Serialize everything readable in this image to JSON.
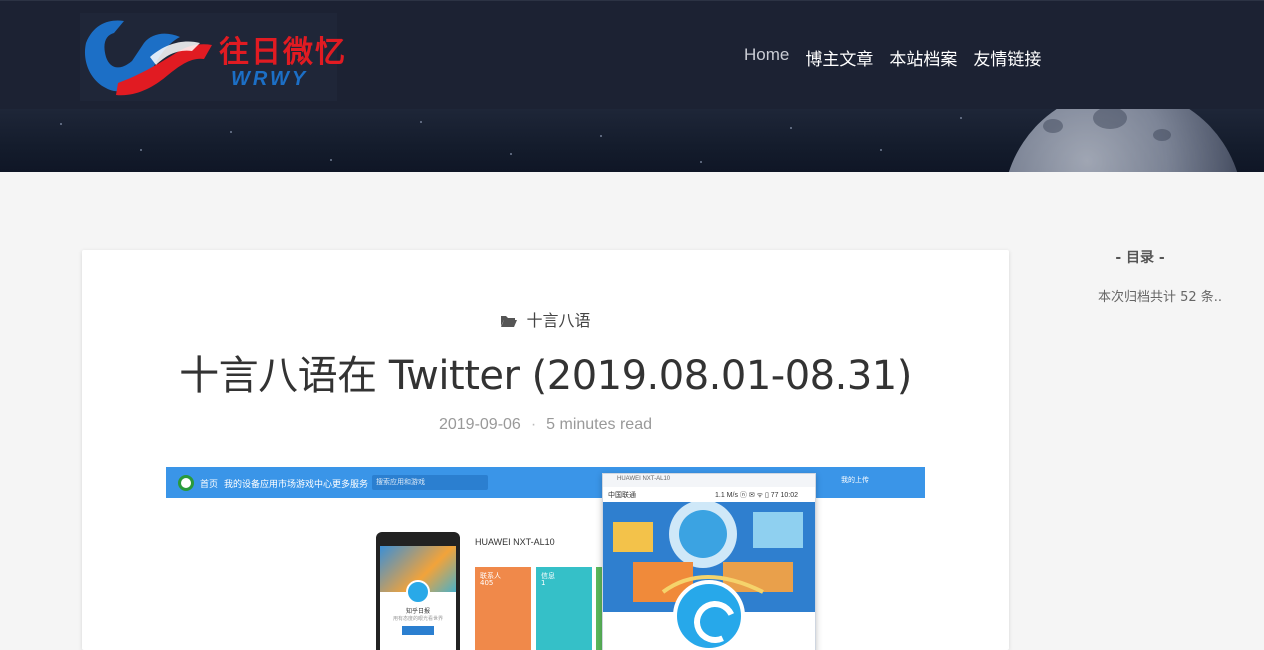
{
  "site": {
    "logo_cn": "往日微忆",
    "logo_en": "WRWY"
  },
  "nav": {
    "items": [
      {
        "label": "Home"
      },
      {
        "label": "博主文章"
      },
      {
        "label": "本站档案"
      },
      {
        "label": "友情链接"
      }
    ]
  },
  "post": {
    "category": "十言八语",
    "title": "十言八语在 Twitter (2019.08.01-08.31)",
    "date": "2019-09-06",
    "separator": "·",
    "read_time": "5 minutes read"
  },
  "post_image": {
    "nav_items": [
      "首页",
      "我的设备",
      "应用市场",
      "游戏中心",
      "更多服务"
    ],
    "search_placeholder": "搜索应用和游戏",
    "right_label": "我的上传",
    "phone_title": "知乎日报",
    "phone_subtitle": "用有态度的眼光看世界",
    "device_title": "HUAWEI NXT-AL10",
    "tiles": [
      {
        "label": "联系人",
        "count": "405",
        "color": "#f0894a"
      },
      {
        "label": "信息",
        "count": "1",
        "color": "#35c0c8"
      }
    ],
    "window_title": "HUAWEI NXT-AL10",
    "window_carrier": "中国联通",
    "window_status": "1.1 M/s  ⓝ ✉ ᯤ ▯ 77  10:02"
  },
  "sidebar": {
    "toc_title": "- 目录 -",
    "archive_text": "本次归档共计 52 条.."
  },
  "colors": {
    "header_bg": "#1c2233",
    "logo_red": "#e11b22",
    "logo_blue": "#1c6fc6",
    "page_bg": "#f5f5f5"
  }
}
